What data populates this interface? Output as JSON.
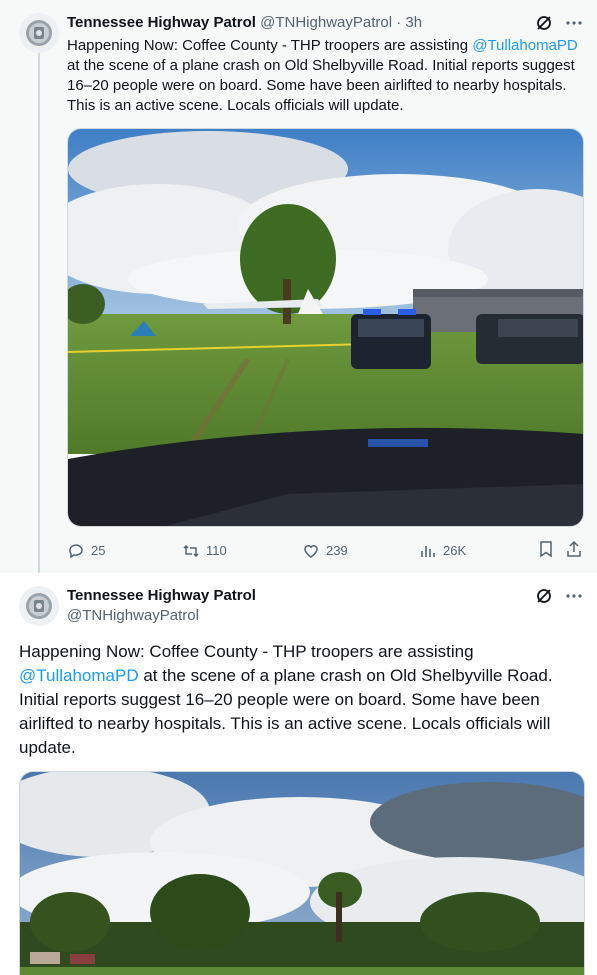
{
  "tweet1": {
    "author_name": "Tennessee Highway Patrol",
    "handle": "@TNHighwayPatrol",
    "separator": "·",
    "time": "3h",
    "text_before_mention": "Happening Now: Coffee County - THP troopers are assisting",
    "mention": "@TullahomaPD",
    "text_after_mention": " at the scene of a plane crash on Old Shelbyville Road. Initial reports suggest 16–20 people were on board. Some have been airlifted to nearby hospitals. This is an active scene. Locals officials will update.",
    "icons": [
      "grok-icon",
      "more-icon"
    ],
    "media_description_icon": "photo",
    "actions": {
      "replies": "25",
      "reposts": "110",
      "likes": "239",
      "views": "26K"
    }
  },
  "tweet2": {
    "author_name": "Tennessee Highway Patrol",
    "handle": "@TNHighwayPatrol",
    "text_before_mention": "Happening Now: Coffee County - THP troopers are assisting",
    "mention": "@TullahomaPD",
    "text_after_mention": " at the scene of a plane crash on Old Shelbyville Road. Initial reports suggest 16–20 people were on board. Some have been airlifted to nearby hospitals. This is an active scene. Locals officials will update.",
    "icons": [
      "grok-icon",
      "more-icon"
    ]
  },
  "colors": {
    "accent": "#1d9bf0",
    "muted_text": "#536471",
    "thread_line": "#cfd9de",
    "tweet1_bg": "#f7f9f9"
  }
}
